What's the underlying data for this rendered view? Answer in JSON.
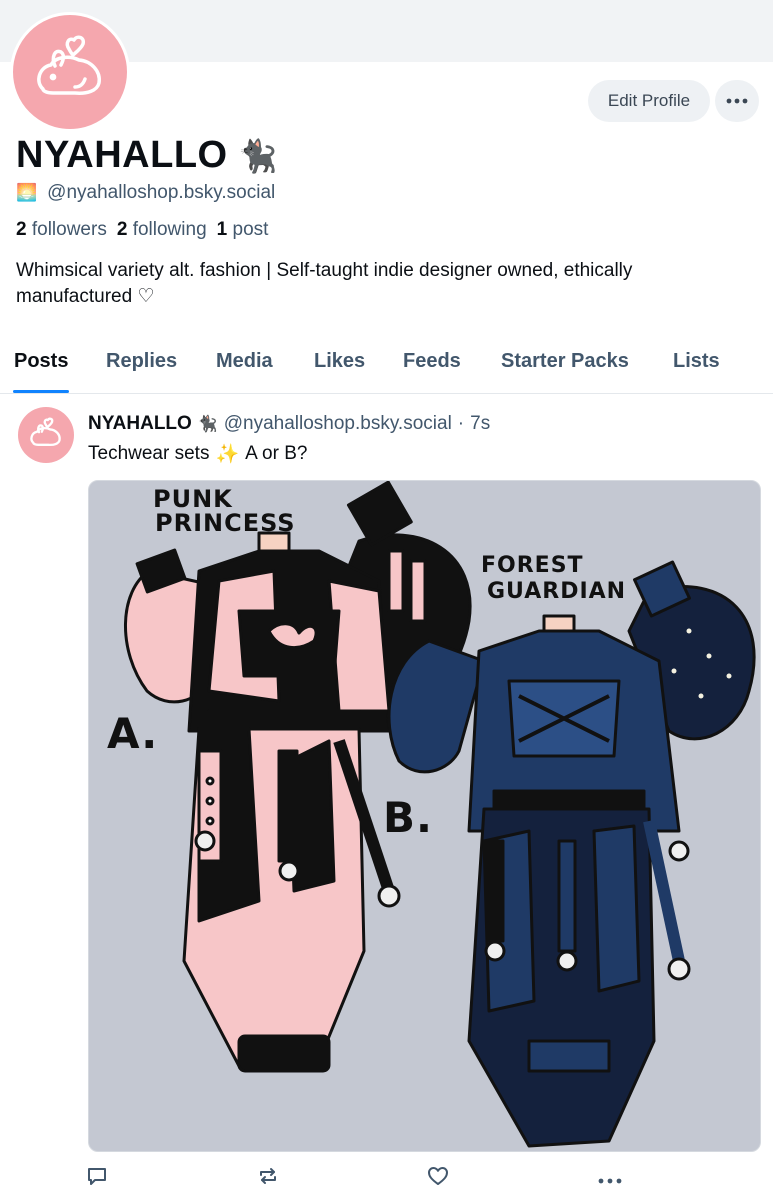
{
  "profile": {
    "display_name": "NYAHALLO",
    "name_emoji": "🐈‍⬛",
    "handle": "@nyahalloshop.bsky.social",
    "handle_emoji": "🌅",
    "followers_count": "2",
    "followers_label": "followers",
    "following_count": "2",
    "following_label": "following",
    "posts_count": "1",
    "posts_label": "post",
    "bio": "Whimsical variety alt. fashion | Self-taught indie designer owned, ethically manufactured ♡",
    "avatar_color": "#f5a7ae"
  },
  "header_actions": {
    "edit_profile_label": "Edit Profile",
    "more_icon": "ellipsis-icon"
  },
  "tabs": [
    {
      "label": "Posts",
      "active": true
    },
    {
      "label": "Replies"
    },
    {
      "label": "Media"
    },
    {
      "label": "Likes"
    },
    {
      "label": "Feeds"
    },
    {
      "label": "Starter Packs"
    },
    {
      "label": "Lists"
    }
  ],
  "post": {
    "author_name": "NYAHALLO",
    "author_emoji": "🐈‍⬛",
    "author_handle": "@nyahalloshop.bsky.social",
    "separator": "·",
    "time": "7s",
    "text_before": "Techwear sets",
    "text_emoji": "✨",
    "text_after": "A or B?",
    "image": {
      "label_a_line1": "PUNK",
      "label_a_line2": "PRINCESS",
      "label_b_line1": "FOREST",
      "label_b_line2": "GUARDIAN",
      "marker_a": "A.",
      "marker_b": "B."
    },
    "actions": [
      "reply-icon",
      "repost-icon",
      "like-icon",
      "more-icon"
    ]
  },
  "colors": {
    "accent": "#1083fe",
    "muted_text": "#42576c",
    "pink": "#f5a7ae",
    "outfit_pink": "#f7c6c8",
    "outfit_navy": "#1f3a66"
  }
}
